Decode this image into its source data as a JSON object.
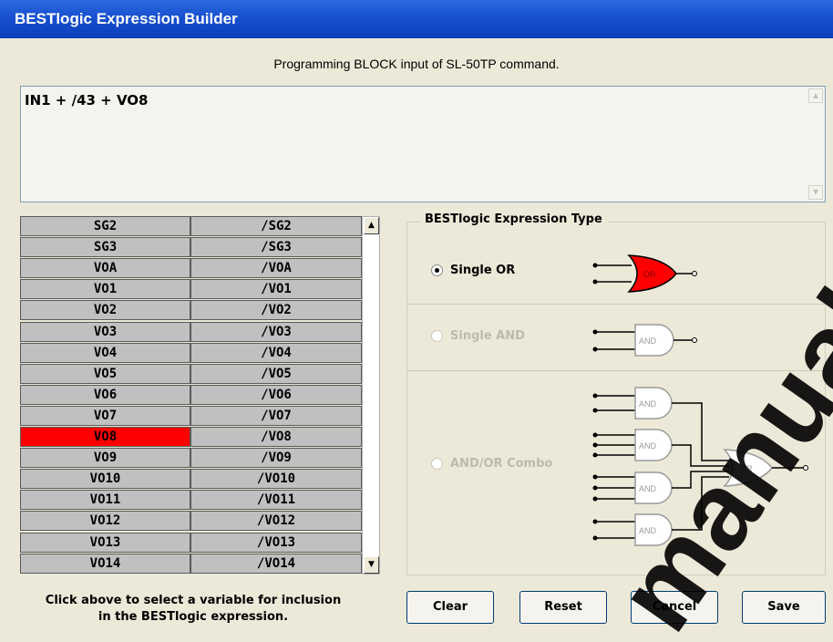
{
  "window": {
    "title": "BESTlogic Expression Builder"
  },
  "subtitle": "Programming BLOCK input of SL-50TP command.",
  "expression": {
    "value": "IN1 + /43 + VO8"
  },
  "variables": [
    [
      "SG2",
      "/SG2"
    ],
    [
      "SG3",
      "/SG3"
    ],
    [
      "VOA",
      "/VOA"
    ],
    [
      "VO1",
      "/VO1"
    ],
    [
      "VO2",
      "/VO2"
    ],
    [
      "VO3",
      "/VO3"
    ],
    [
      "VO4",
      "/VO4"
    ],
    [
      "VO5",
      "/VO5"
    ],
    [
      "VO6",
      "/VO6"
    ],
    [
      "VO7",
      "/VO7"
    ],
    [
      "VO8",
      "/VO8"
    ],
    [
      "VO9",
      "/VO9"
    ],
    [
      "VO10",
      "/VO10"
    ],
    [
      "VO11",
      "/VO11"
    ],
    [
      "VO12",
      "/VO12"
    ],
    [
      "VO13",
      "/VO13"
    ],
    [
      "VO14",
      "/VO14"
    ]
  ],
  "selected_variable": "VO8",
  "hint": {
    "line1": "Click above to select a variable for inclusion",
    "line2": "in the BESTlogic expression."
  },
  "expression_type": {
    "title": "BESTlogic Expression Type",
    "options": [
      {
        "label": "Single OR",
        "selected": true,
        "enabled": true
      },
      {
        "label": "Single AND",
        "selected": false,
        "enabled": false
      },
      {
        "label": "AND/OR Combo",
        "selected": false,
        "enabled": false
      }
    ],
    "gate_labels": {
      "or": "OR",
      "and": "AND"
    }
  },
  "buttons": {
    "clear": "Clear",
    "reset": "Reset",
    "cancel": "Cancel",
    "save": "Save"
  },
  "watermark": "manual",
  "colors": {
    "selected": "#FF0000",
    "title_bar": "#1650D0",
    "gate_active": "#FF0000",
    "gate_disabled": "#9A9A9A"
  },
  "icons": {
    "scroll_up": "up-arrow-icon",
    "scroll_down": "down-arrow-icon"
  }
}
